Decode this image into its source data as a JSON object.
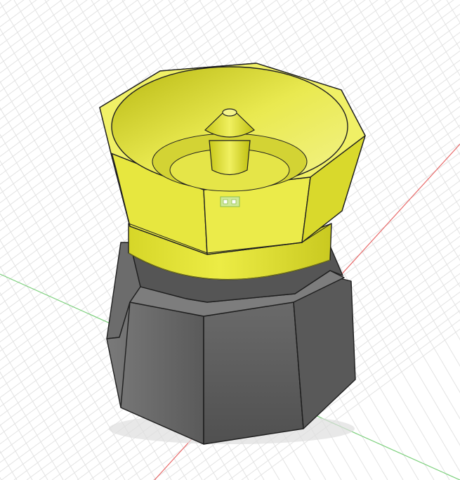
{
  "viewport": {
    "background": "#ffffff",
    "grid_color": "#e3e3e3",
    "axis_x_color": "#e5484d",
    "axis_y_color": "#5bc45b"
  },
  "model": {
    "top_part_color": "#e6e63a",
    "top_part_shade": "#cfcf28",
    "bottom_part_color": "#5d5d5d",
    "bottom_part_shade": "#4a4a4a",
    "edge_color": "#1f1f1f"
  },
  "icons": {
    "sketch_marker": "component-marker-icon"
  }
}
